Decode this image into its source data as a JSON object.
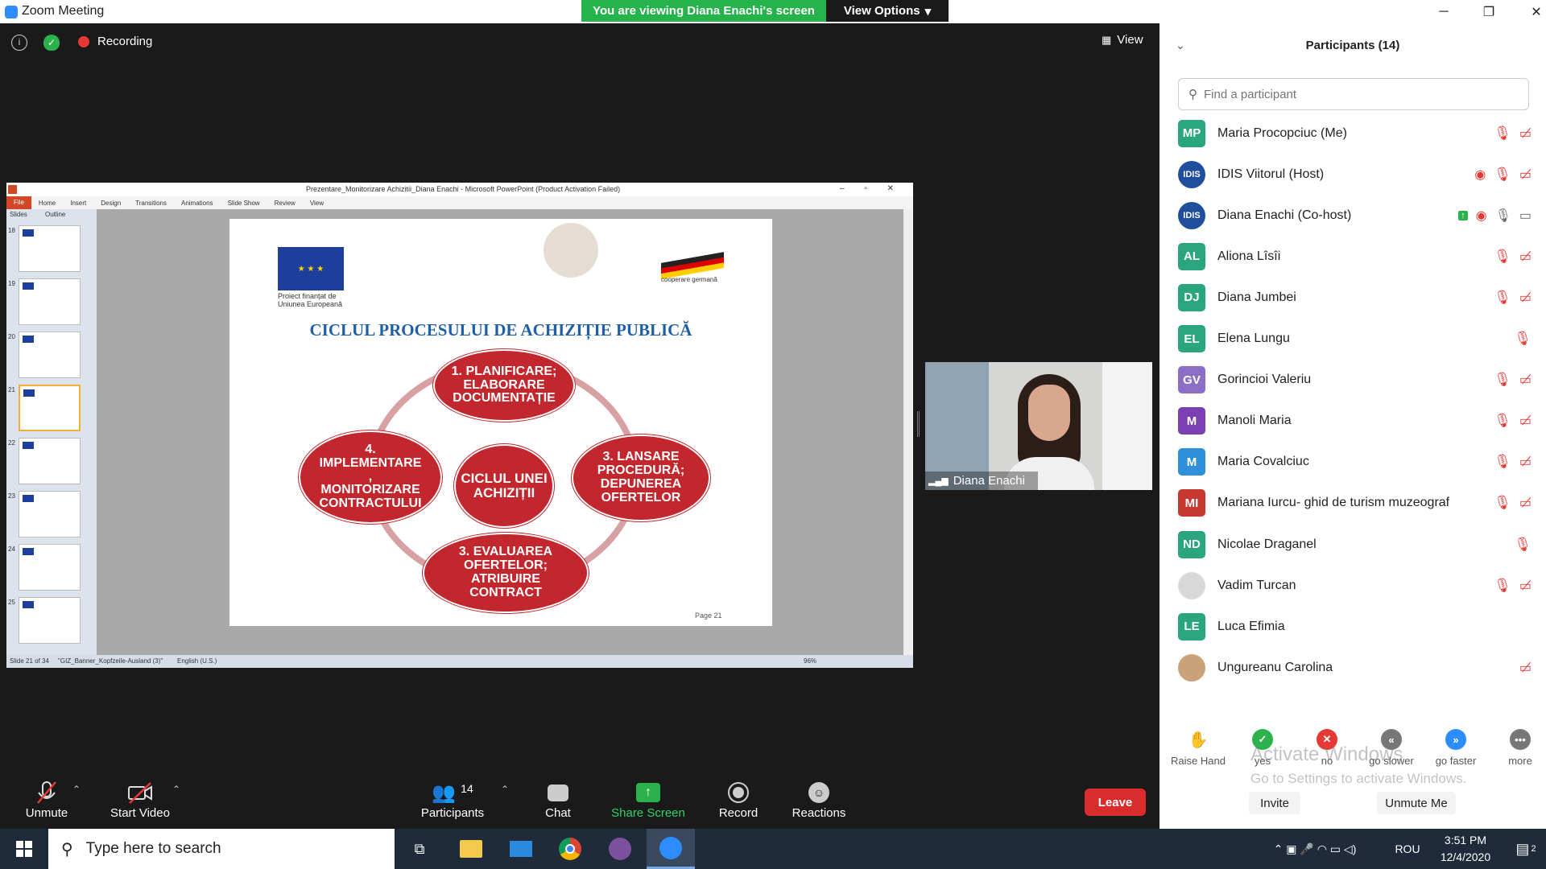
{
  "window": {
    "title": "Zoom Meeting"
  },
  "banner": {
    "viewing": "You are viewing Diana Enachi's screen",
    "view_options": "View Options"
  },
  "meeting": {
    "recording": "Recording",
    "view_label": "View"
  },
  "ppt": {
    "title": "Prezentare_Monitorizare Achizitii_Diana Enachi - Microsoft PowerPoint (Product Activation Failed)",
    "tabs": [
      "File",
      "Home",
      "Insert",
      "Design",
      "Transitions",
      "Animations",
      "Slide Show",
      "Review",
      "View"
    ],
    "pane_tabs": [
      "Slides",
      "Outline"
    ],
    "slide_numbers": [
      "18",
      "19",
      "20",
      "21",
      "22",
      "23",
      "24",
      "25"
    ],
    "status": {
      "slide": "Slide 21 of 34",
      "theme": "\"GIZ_Banner_Kopfzeile-Ausland (3)\"",
      "lang": "English (U.S.)",
      "zoom": "96%"
    },
    "slide": {
      "eu_caption": "Proiect finanțat de Uniunea Europeană",
      "coop_caption": "cooperare germană",
      "heading": "CICLUL PROCESULUI DE ACHIZIȚIE PUBLICĂ",
      "center": "CICLUL UNEI ACHIZIȚII",
      "step1": "1. PLANIFICARE; ELABORARE DOCUMENTAȚIE",
      "step3a": "3. LANSARE PROCEDURĂ; DEPUNEREA OFERTELOR",
      "step3b": "3. EVALUAREA OFERTELOR; ATRIBUIRE CONTRACT",
      "step4": "4. IMPLEMENTARE , MONITORIZARE CONTRACTULUI",
      "page": "Page 21"
    }
  },
  "video": {
    "name": "Diana Enachi"
  },
  "toolbar": {
    "unmute": "Unmute",
    "start_video": "Start Video",
    "participants": "Participants",
    "participants_count": "14",
    "chat": "Chat",
    "share_screen": "Share Screen",
    "record": "Record",
    "reactions": "Reactions",
    "leave": "Leave"
  },
  "panel": {
    "title": "Participants (14)",
    "search_placeholder": "Find a participant",
    "participants": [
      {
        "initials": "MP",
        "name": "Maria Procopciuc (Me)",
        "color": "#2aa57e"
      },
      {
        "initials": "IDIS",
        "name": "IDIS Viitorul (Host)",
        "color": "#1f4e9c"
      },
      {
        "initials": "IDIS",
        "name": "Diana Enachi (Co-host)",
        "color": "#1f4e9c"
      },
      {
        "initials": "AL",
        "name": "Aliona Lîsîi",
        "color": "#2aa57e"
      },
      {
        "initials": "DJ",
        "name": "Diana Jumbei",
        "color": "#2aa57e"
      },
      {
        "initials": "EL",
        "name": "Elena Lungu",
        "color": "#2aa57e"
      },
      {
        "initials": "GV",
        "name": "Gorincioi Valeriu",
        "color": "#8c6fc2"
      },
      {
        "initials": "M",
        "name": "Manoli Maria",
        "color": "#7a3fb0"
      },
      {
        "initials": "M",
        "name": "Maria Covalciuc",
        "color": "#2f8fd8"
      },
      {
        "initials": "MI",
        "name": "Mariana Iurcu- ghid de turism muzeograf",
        "color": "#c7392f"
      },
      {
        "initials": "ND",
        "name": "Nicolae Draganel",
        "color": "#2aa57e"
      },
      {
        "initials": "",
        "name": "Vadim Turcan",
        "color": "#d9d9d9"
      },
      {
        "initials": "LE",
        "name": "Luca Efimia",
        "color": "#2aa57e"
      },
      {
        "initials": "",
        "name": "Ungureanu Carolina",
        "color": "#c9a27a"
      }
    ],
    "reactions": [
      "Raise Hand",
      "yes",
      "no",
      "go slower",
      "go faster",
      "more"
    ],
    "invite": "Invite",
    "unmute_me": "Unmute Me",
    "watermark1": "Activate Windows",
    "watermark2": "Go to Settings to activate Windows."
  },
  "taskbar": {
    "search": "Type here to search",
    "lang": "ROU",
    "time": "3:51 PM",
    "date": "12/4/2020",
    "notif": "2"
  }
}
